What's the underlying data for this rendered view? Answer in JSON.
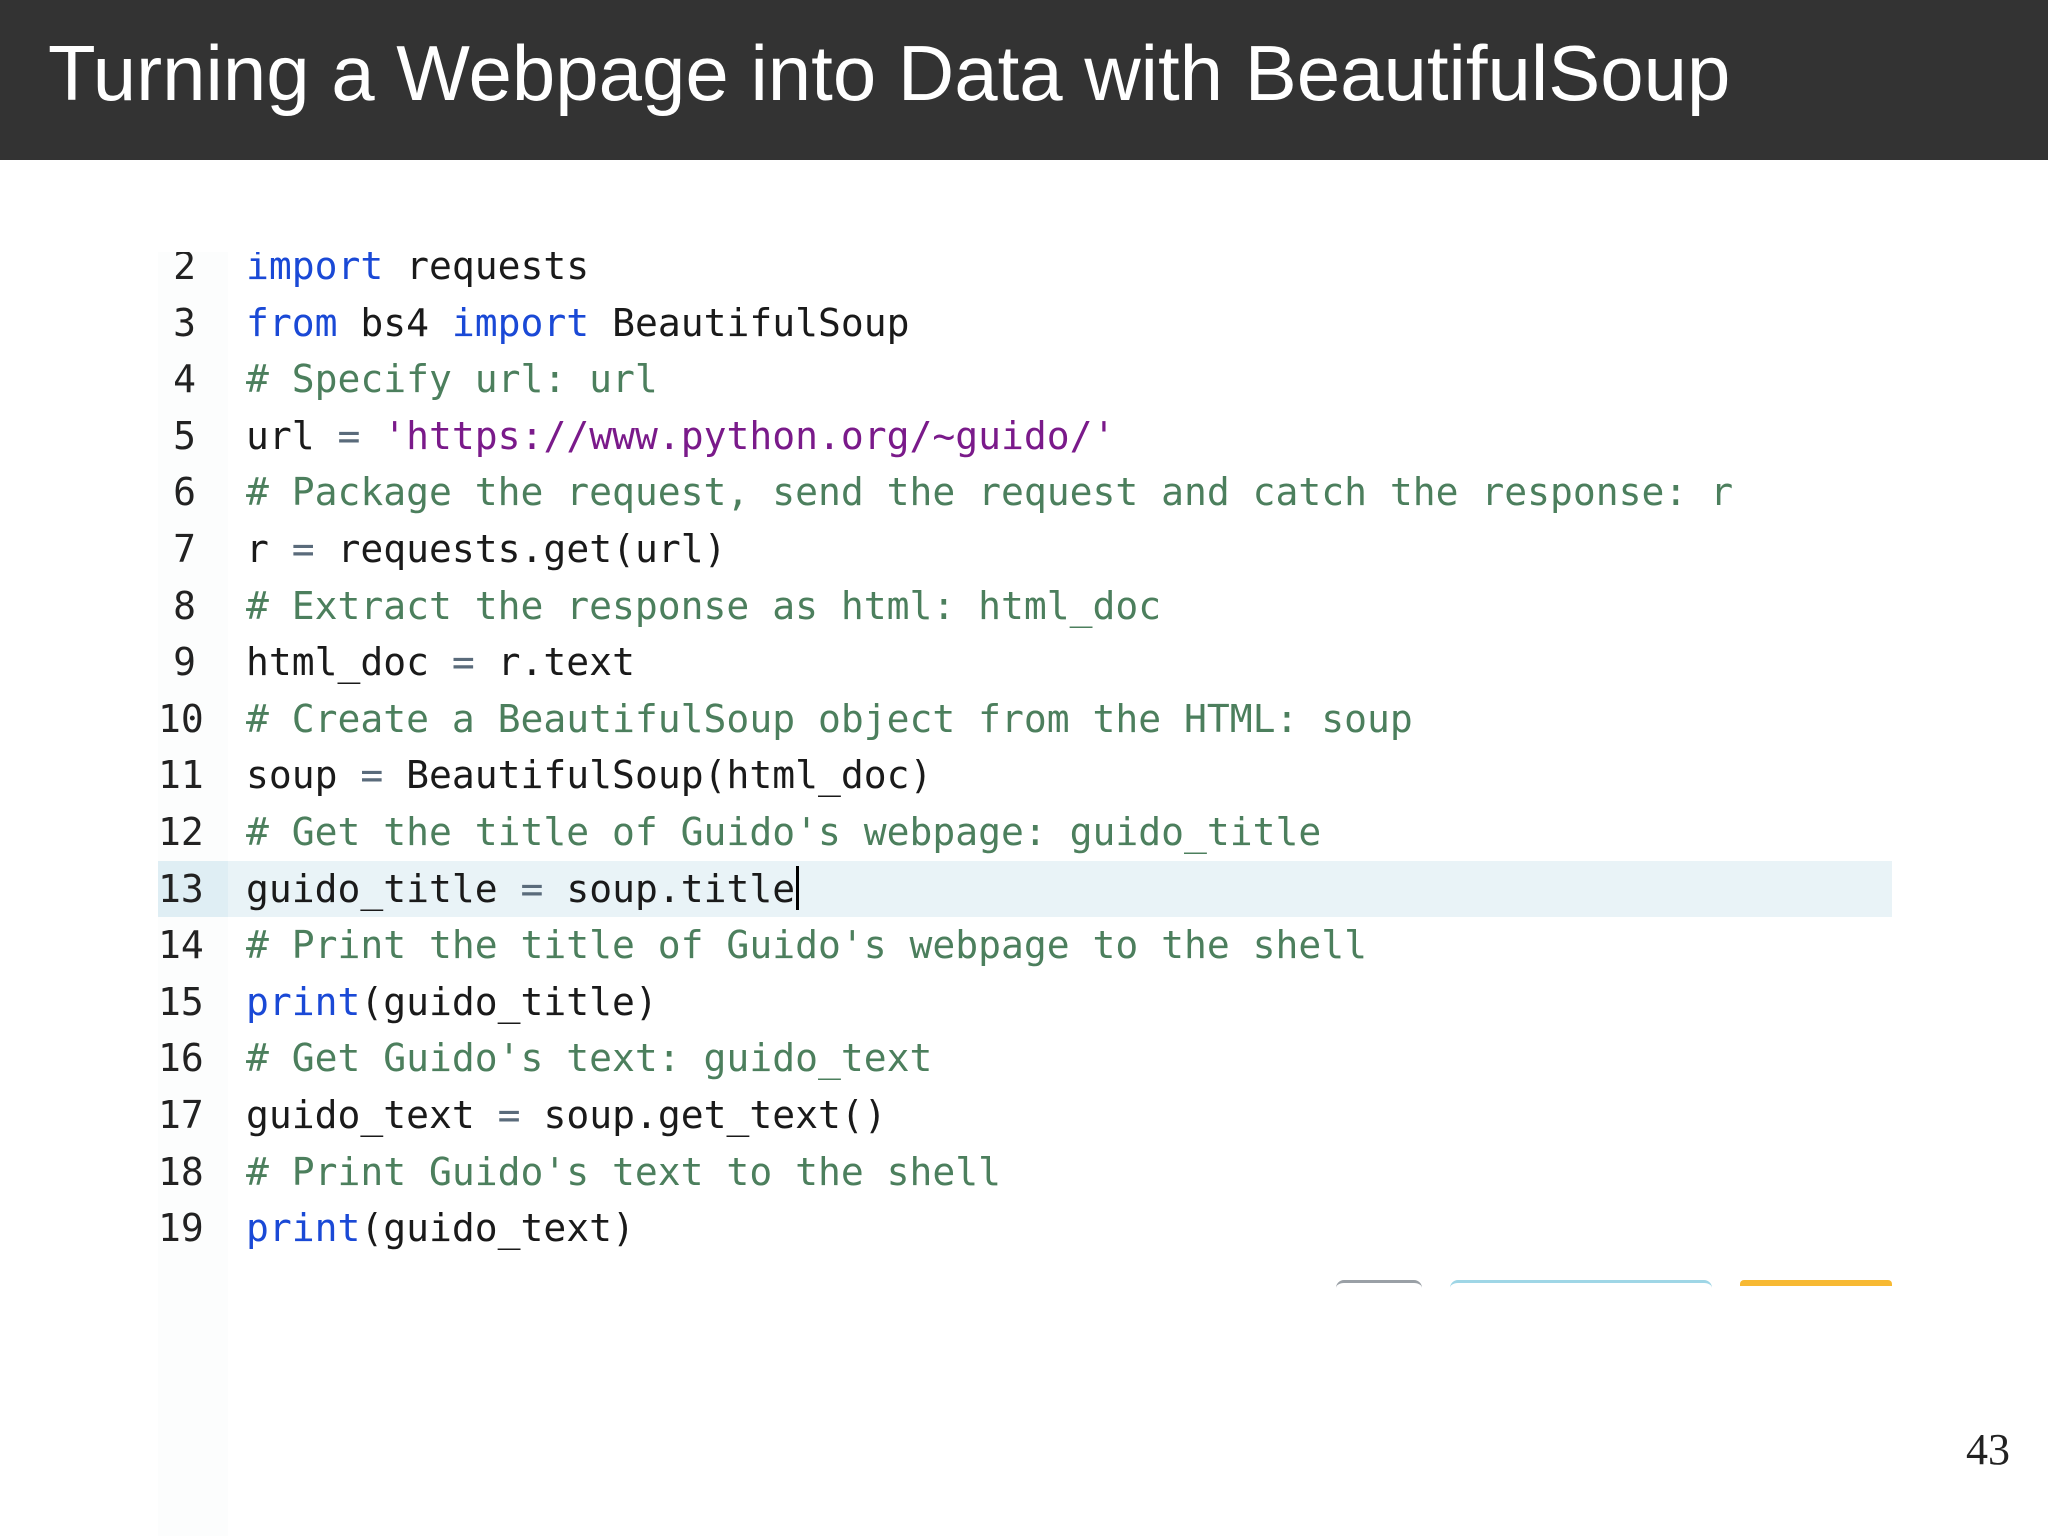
{
  "slide": {
    "title": "Turning a Webpage into Data with BeautifulSoup",
    "page_number": "43"
  },
  "editor": {
    "active_line": "13",
    "lines": [
      {
        "num": "2",
        "tokens": [
          {
            "t": "kw",
            "v": "import"
          },
          {
            "t": "txt",
            "v": " requests"
          }
        ]
      },
      {
        "num": "3",
        "tokens": [
          {
            "t": "kw",
            "v": "from"
          },
          {
            "t": "txt",
            "v": " bs4 "
          },
          {
            "t": "kw",
            "v": "import"
          },
          {
            "t": "txt",
            "v": " BeautifulSoup"
          }
        ]
      },
      {
        "num": "4",
        "tokens": [
          {
            "t": "cmt",
            "v": "# Specify url: url"
          }
        ]
      },
      {
        "num": "5",
        "tokens": [
          {
            "t": "txt",
            "v": "url "
          },
          {
            "t": "op",
            "v": "="
          },
          {
            "t": "txt",
            "v": " "
          },
          {
            "t": "str",
            "v": "'https://www.python.org/~guido/'"
          }
        ]
      },
      {
        "num": "6",
        "tokens": [
          {
            "t": "cmt",
            "v": "# Package the request, send the request and catch the response: r"
          }
        ]
      },
      {
        "num": "7",
        "tokens": [
          {
            "t": "txt",
            "v": "r "
          },
          {
            "t": "op",
            "v": "="
          },
          {
            "t": "txt",
            "v": " requests.get(url)"
          }
        ]
      },
      {
        "num": "8",
        "tokens": [
          {
            "t": "cmt",
            "v": "# Extract the response as html: html_doc"
          }
        ]
      },
      {
        "num": "9",
        "tokens": [
          {
            "t": "txt",
            "v": "html_doc "
          },
          {
            "t": "op",
            "v": "="
          },
          {
            "t": "txt",
            "v": " r.text"
          }
        ]
      },
      {
        "num": "10",
        "tokens": [
          {
            "t": "cmt",
            "v": "# Create a BeautifulSoup object from the HTML: soup"
          }
        ]
      },
      {
        "num": "11",
        "tokens": [
          {
            "t": "txt",
            "v": "soup "
          },
          {
            "t": "op",
            "v": "="
          },
          {
            "t": "txt",
            "v": " BeautifulSoup(html_doc)"
          }
        ]
      },
      {
        "num": "12",
        "tokens": [
          {
            "t": "cmt",
            "v": "# Get the title of Guido's webpage: guido_title"
          }
        ]
      },
      {
        "num": "13",
        "tokens": [
          {
            "t": "txt",
            "v": "guido_title "
          },
          {
            "t": "op",
            "v": "="
          },
          {
            "t": "txt",
            "v": " soup.title"
          }
        ]
      },
      {
        "num": "14",
        "tokens": [
          {
            "t": "cmt",
            "v": "# Print the title of Guido's webpage to the shell"
          }
        ]
      },
      {
        "num": "15",
        "tokens": [
          {
            "t": "kw",
            "v": "print"
          },
          {
            "t": "txt",
            "v": "(guido_title)"
          }
        ]
      },
      {
        "num": "16",
        "tokens": [
          {
            "t": "cmt",
            "v": "# Get Guido's text: guido_text"
          }
        ]
      },
      {
        "num": "17",
        "tokens": [
          {
            "t": "txt",
            "v": "guido_text "
          },
          {
            "t": "op",
            "v": "="
          },
          {
            "t": "txt",
            "v": " soup.get_text()"
          }
        ]
      },
      {
        "num": "18",
        "tokens": [
          {
            "t": "cmt",
            "v": "# Print Guido's text to the shell"
          }
        ]
      },
      {
        "num": "19",
        "tokens": [
          {
            "t": "kw",
            "v": "print"
          },
          {
            "t": "txt",
            "v": "(guido_text)"
          }
        ]
      }
    ]
  },
  "colors": {
    "title_bar": "#333333",
    "keyword": "#1a49d6",
    "comment": "#4c7f5d",
    "string": "#7a1a8a",
    "active_line_bg": "#e9f3f7"
  }
}
